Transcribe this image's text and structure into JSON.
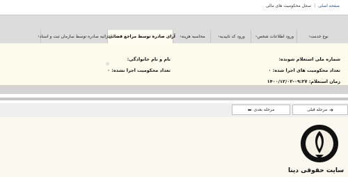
{
  "breadcrumb": {
    "home": "صفحه اصلی",
    "separator": "|",
    "current": "سجل محکومیت های مالی"
  },
  "tabs": [
    {
      "label": "نوع خدمت"
    },
    {
      "label": "ورود اطلاعات شخص"
    },
    {
      "label": "ورود کد تاییدیه"
    },
    {
      "label": "محاسبه هزینه"
    },
    {
      "label": "آرای صادره توسط مراجع قضائی"
    },
    {
      "label": "اجرائیه صادره توسط سازمان ثبت و اسناد"
    }
  ],
  "active_tab_index": 4,
  "tab_chevron": "‹",
  "panel": {
    "national_id_label": "شماره ملی استعلام شونده:",
    "executed_count_label": "تعداد محکومیت های اجرا شده: ۰",
    "inquiry_time_label": "زمان استعلام: ۰۹:۲۷-۱۴۰۰/۱۲/۰۲",
    "full_name_label": "نام و نام خانوادگی:",
    "not_executed_count_label": "تعداد محکومیت اجرا نشده: ۰"
  },
  "buttons": {
    "previous": "مرحله قبلی",
    "next": "مرحله بعدی"
  },
  "footer": {
    "site_title": "سایت حقوقی دینا"
  },
  "colors": {
    "panel_bg": "#fcfcec",
    "band_gray": "#dcdcdc",
    "link_blue": "#2b4f8a"
  },
  "icons": {
    "prev_arrow": "➜",
    "next_arrow": "⬅"
  }
}
